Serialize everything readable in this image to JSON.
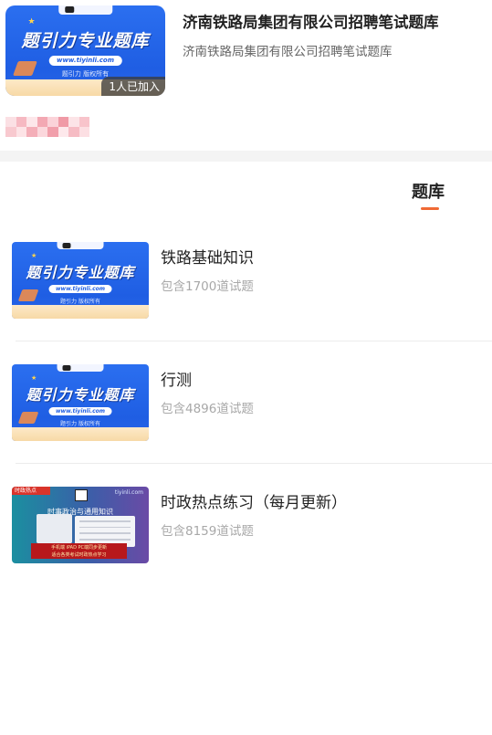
{
  "course": {
    "title": "济南铁路局集团有限公司招聘笔试题库",
    "subtitle": "济南铁路局集团有限公司招聘笔试题库",
    "joined_badge": "1人已加入",
    "cover": {
      "headline": "题引力专业题库",
      "url": "www.tiyinli.com",
      "caption": "题引力 版权所有"
    }
  },
  "tabs": {
    "active": "题库"
  },
  "bank_list": [
    {
      "name": "铁路基础知识",
      "count": "包含1700道试题",
      "cover": {
        "headline": "题引力专业题库",
        "url": "www.tiyinli.com",
        "caption": "题引力 版权所有"
      }
    },
    {
      "name": "行测",
      "count": "包含4896道试题",
      "cover": {
        "headline": "题引力专业题库",
        "url": "www.tiyinli.com",
        "caption": "题引力 版权所有"
      }
    },
    {
      "name": "时政热点练习（每月更新）",
      "count": "包含8159道试题",
      "cover": {
        "tag": "时政热点",
        "site": "tiyinli.com",
        "headline": "时事政治与通用知识",
        "banner_line1": "手机端 iPAD PC端同步更新",
        "banner_line2": "适合各类考试时政热点学习"
      }
    }
  ],
  "colors": {
    "accent": "#f06a35",
    "cover_blue": "#1f5ee3",
    "separator": "#ececec",
    "muted_text": "#a8a8a8"
  },
  "icons": {
    "avatar_strip": "pixelated-avatars",
    "cover_star": "star-icon"
  }
}
